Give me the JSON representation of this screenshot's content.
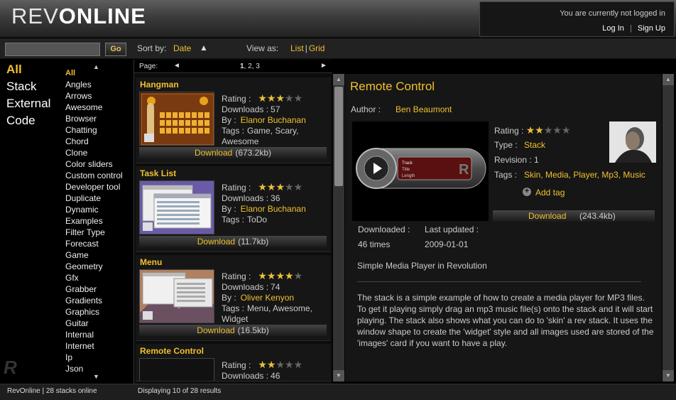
{
  "header": {
    "logo_light": "REV",
    "logo_bold": "ONLINE",
    "login_message": "You are currently not logged in",
    "login_link": "Log In",
    "separator": "|",
    "signup_link": "Sign Up"
  },
  "toolbar": {
    "search_value": "",
    "go_label": "Go",
    "sort_label": "Sort by:",
    "sort_value": "Date",
    "sort_arrow": "▲",
    "view_label": "View as:",
    "view_list": "List",
    "view_sep": "|",
    "view_grid": "Grid"
  },
  "sidebar": {
    "main_categories": [
      "All",
      "Stack",
      "External",
      "Code"
    ],
    "sub_categories": [
      "All",
      "Angles",
      "Arrows",
      "Awesome",
      "Browser",
      "Chatting",
      "Chord",
      "Clone",
      "Color sliders",
      "Custom control",
      "Developer tool",
      "Duplicate",
      "Dynamic",
      "Examples",
      "Filter Type",
      "Forecast",
      "Game",
      "Geometry",
      "Gfx",
      "Grabber",
      "Gradients",
      "Graphics",
      "Guitar",
      "Internal",
      "Internet",
      "Ip",
      "Json"
    ]
  },
  "pager": {
    "label": "Page:",
    "prev": "◄",
    "current": "1",
    "others": ", 2, 3",
    "next": "►"
  },
  "list": {
    "rating_label": "Rating :",
    "downloads_label": "Downloads :",
    "by_label": "By :",
    "tags_label": "Tags :",
    "download_label": "Download",
    "items": [
      {
        "title": "Hangman",
        "rating": 3,
        "downloads": "57",
        "author": "Elanor Buchanan",
        "tags_line1": "Game, Scary,",
        "tags_line2": "Awesome",
        "size": "(673.2kb)"
      },
      {
        "title": "Task List",
        "rating": 3,
        "downloads": "36",
        "author": "Elanor Buchanan",
        "tags_line1": "ToDo",
        "tags_line2": "",
        "size": "(11.7kb)"
      },
      {
        "title": "Menu",
        "rating": 4,
        "downloads": "74",
        "author": "Oliver Kenyon",
        "tags_line1": "Menu, Awesome,",
        "tags_line2": "Widget",
        "size": "(16.5kb)"
      },
      {
        "title": "Remote Control",
        "rating": 2,
        "downloads": "46",
        "author": "",
        "tags_line1": "",
        "tags_line2": "",
        "size": ""
      }
    ]
  },
  "detail": {
    "title": "Remote Control",
    "author_label": "Author :",
    "author": "Ben Beaumont",
    "rating_label": "Rating :",
    "rating": 2,
    "type_label": "Type :",
    "type": "Stack",
    "revision_label": "Revision :",
    "revision": "1",
    "tags_label": "Tags :",
    "tags": "Skin, Media, Player, Mp3, Music",
    "add_tag": "Add tag",
    "add_tag_icon": "+",
    "download_label": "Download",
    "download_size": "(243.4kb)",
    "downloaded_label": "Downloaded :",
    "downloaded_value": "46 times",
    "updated_label": "Last updated :",
    "updated_value": "2009-01-01",
    "subtitle": "Simple Media Player in Revolution",
    "description": "The stack is a simple example of how to create a media player for MP3 files. To get it playing simply drag an mp3 music file(s) onto the stack and it will start playing. The stack also shows what you can do to 'skin' a rev stack. It uses the window shape to create the 'widget' style and all images used are stored of the 'images' card if you want to have a play.",
    "player_labels": [
      "Track",
      "Title",
      "Length"
    ]
  },
  "status": {
    "left": "RevOnline | 28 stacks online",
    "right": "Displaying 10 of 28 results"
  },
  "colors": {
    "accent": "#f0c030",
    "background": "#000000",
    "panel": "#161616"
  },
  "icons": {
    "up": "▲",
    "down": "▼",
    "star": "★"
  }
}
